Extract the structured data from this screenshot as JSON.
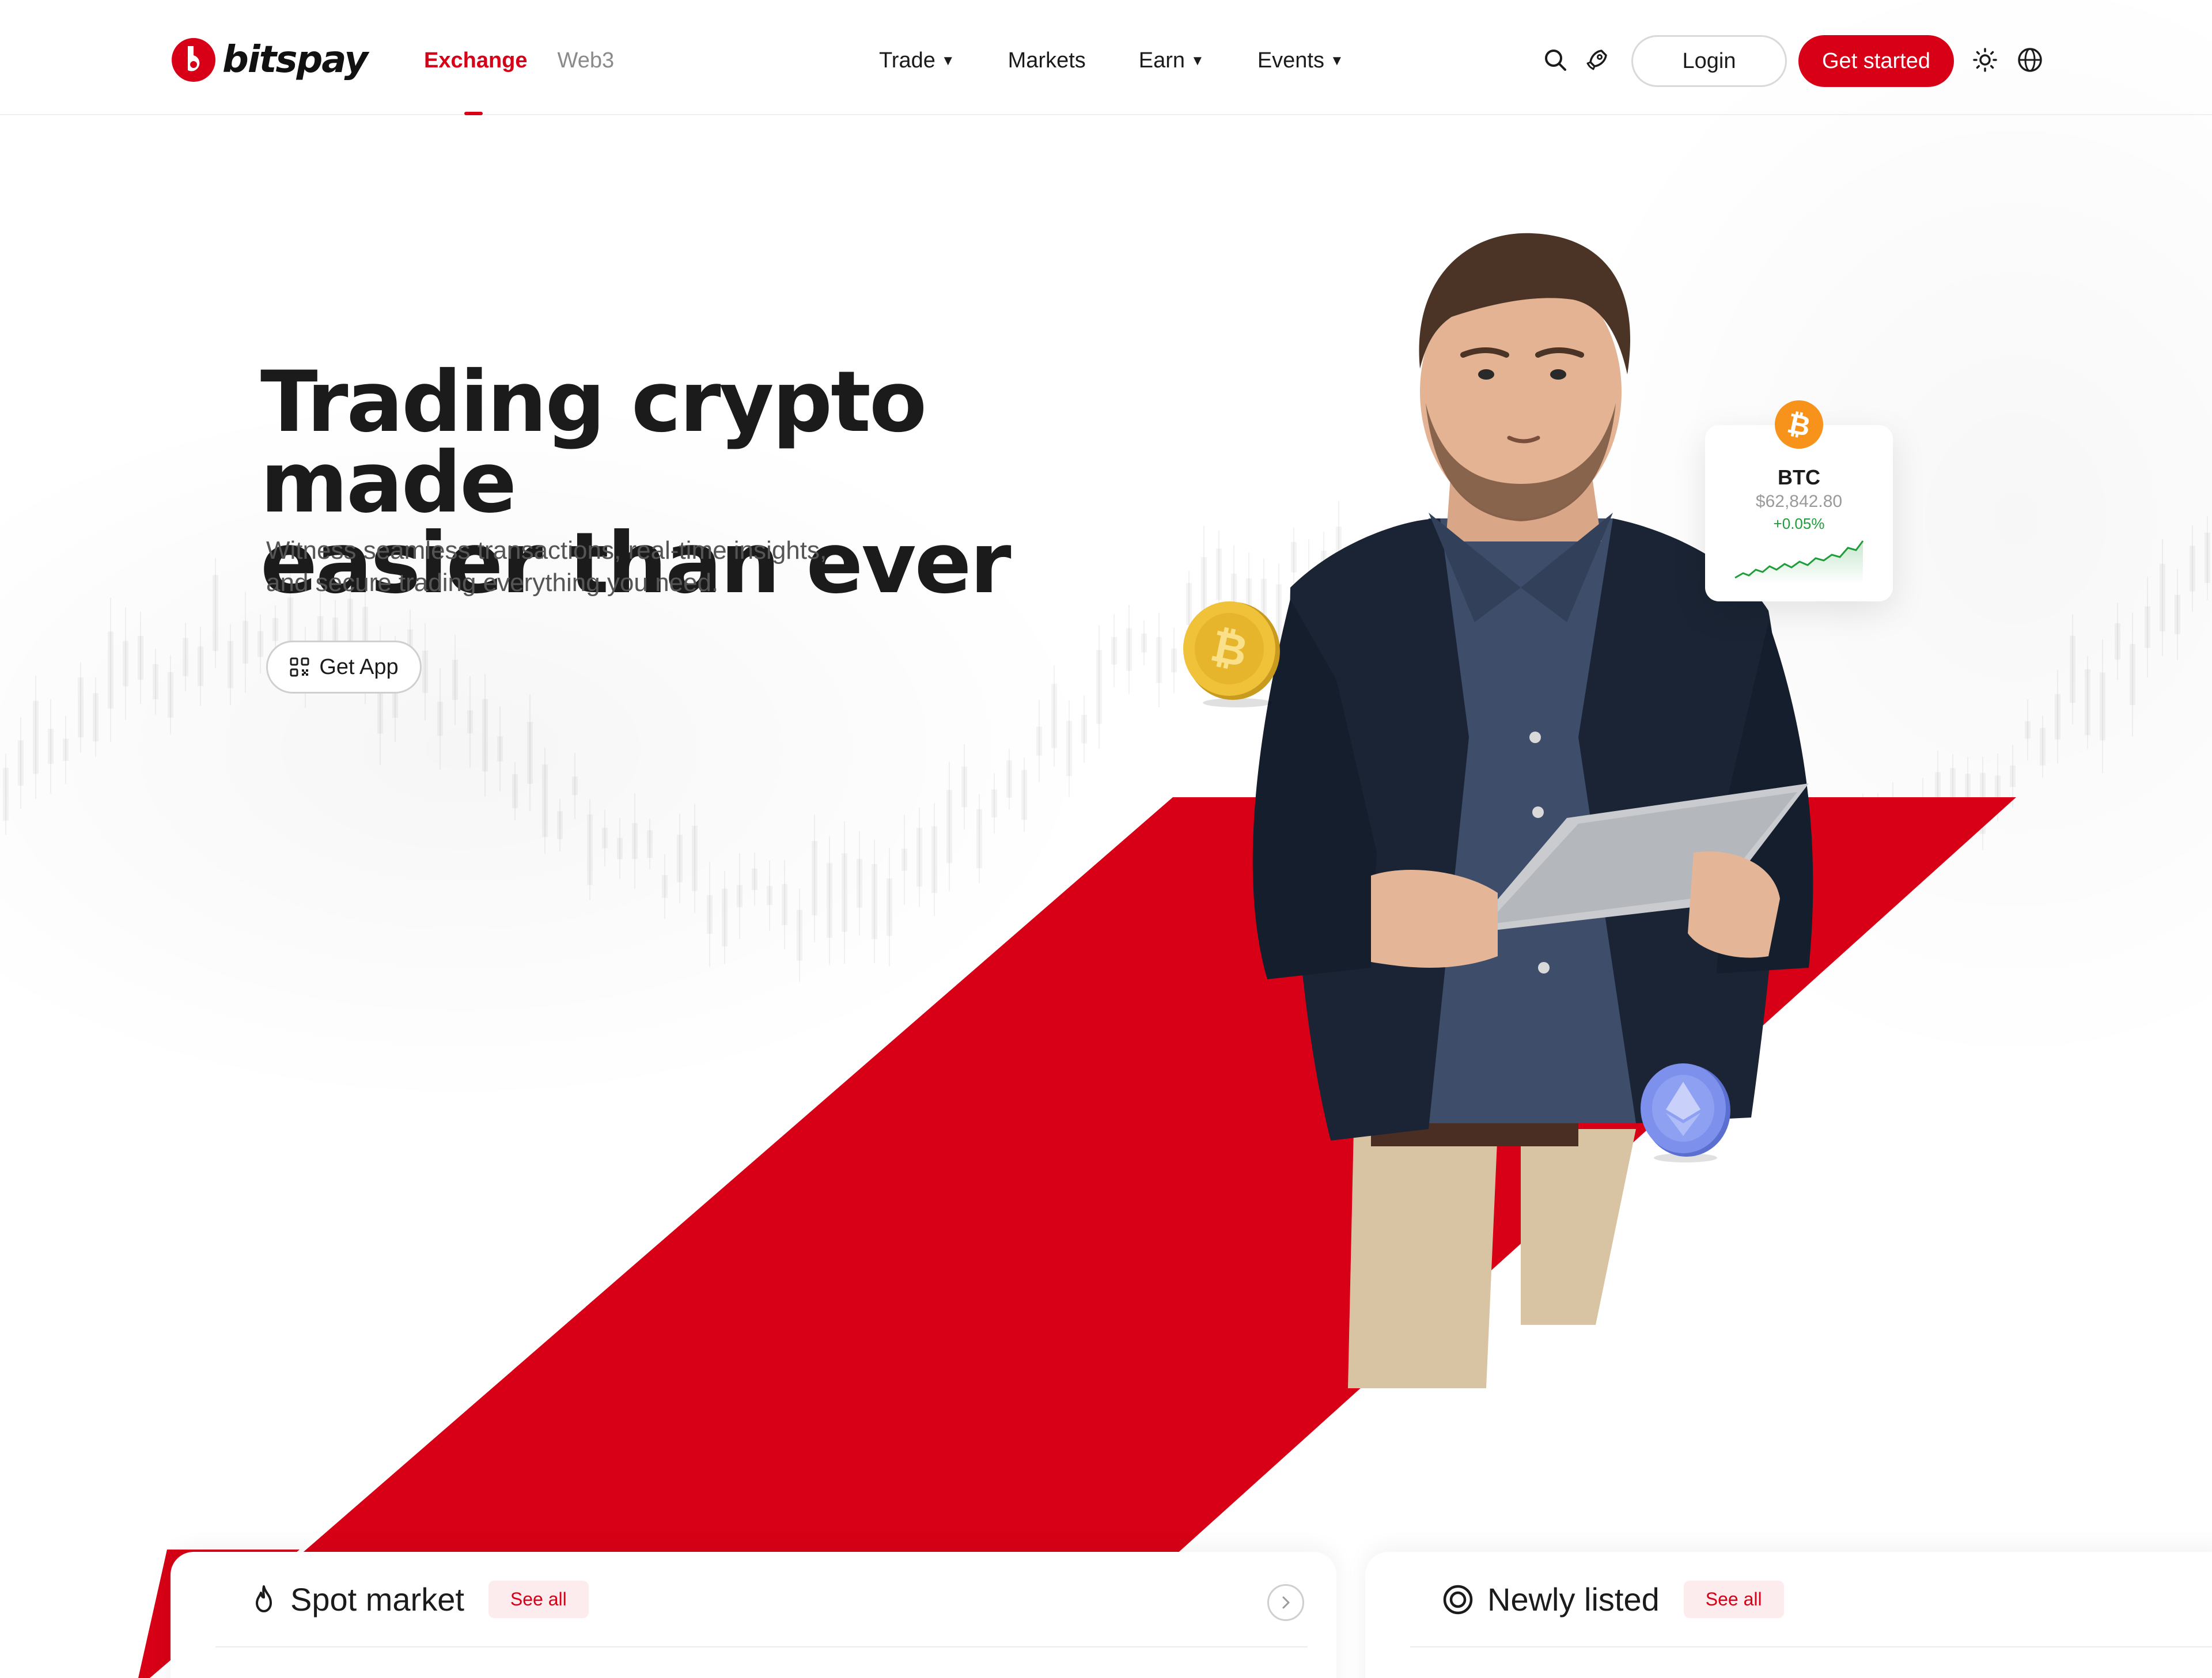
{
  "brand": {
    "name": "bitspay",
    "accent_color": "#d70016"
  },
  "header": {
    "tabs": [
      {
        "label": "Exchange",
        "active": true
      },
      {
        "label": "Web3",
        "active": false
      }
    ],
    "nav": [
      {
        "label": "Trade",
        "has_dropdown": true
      },
      {
        "label": "Markets",
        "has_dropdown": false
      },
      {
        "label": "Earn",
        "has_dropdown": true
      },
      {
        "label": "Events",
        "has_dropdown": true
      }
    ],
    "icons": [
      "search-icon",
      "rocket-icon",
      "sun-icon",
      "globe-icon"
    ],
    "login_label": "Login",
    "get_started_label": "Get started"
  },
  "hero": {
    "title_line1": "Trading crypto made",
    "title_line2": "easier than ever",
    "subtitle_line1": "Witness seamless transactions, real-time insights,",
    "subtitle_line2": "and secure trading everything you need.",
    "get_app_label": "Get App",
    "get_app_icon": "qr-code-icon"
  },
  "ticker_card": {
    "symbol": "BTC",
    "price": "$62,842.80",
    "change": "+0.05%",
    "change_color": "#1f9d3a",
    "icon": "bitcoin-icon"
  },
  "sections": {
    "spot_market": {
      "title": "Spot market",
      "see_all": "See all",
      "icon": "fire-icon"
    },
    "newly_listed": {
      "title": "Newly listed",
      "see_all": "See all",
      "icon": "target-icon"
    }
  }
}
